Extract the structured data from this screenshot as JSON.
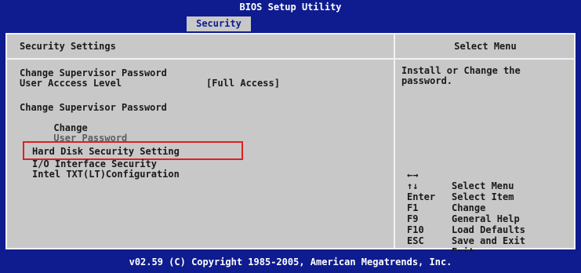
{
  "title": "BIOS Setup Utility",
  "active_tab": "Security",
  "left_header": "Security Settings",
  "right_header": "Select Menu",
  "items": [
    {
      "label": "Change Supervisor Password"
    },
    {
      "label": "User Acccess Level",
      "value": "[Full Access]"
    },
    {
      "label": "Change Supervisor Password"
    },
    {
      "label_prefix": "Change",
      "label_dim": "User Password"
    },
    {
      "label": "Hard Disk Security Setting"
    },
    {
      "label": "I/O Interface Security"
    },
    {
      "label": "Intel TXT(LT)Configuration"
    }
  ],
  "help_text": "Install or Change the\npassword.",
  "keys": [
    {
      "key": "←→",
      "desc": "Select Menu"
    },
    {
      "key": "↑↓",
      "desc": "Select Item"
    },
    {
      "key": "Enter",
      "desc": "Change"
    },
    {
      "key": "F1",
      "desc": "General Help"
    },
    {
      "key": "F9",
      "desc": "Load Defaults"
    },
    {
      "key": "F10",
      "desc": "Save and Exit"
    },
    {
      "key": "ESC",
      "desc": "Exit"
    }
  ],
  "footer": "v02.59 (C) Copyright 1985-2005, American Megatrends, Inc.",
  "colors": {
    "background_blue": "#0e1c8f",
    "panel_gray": "#c8c8c8",
    "highlight_red": "#e02020"
  }
}
